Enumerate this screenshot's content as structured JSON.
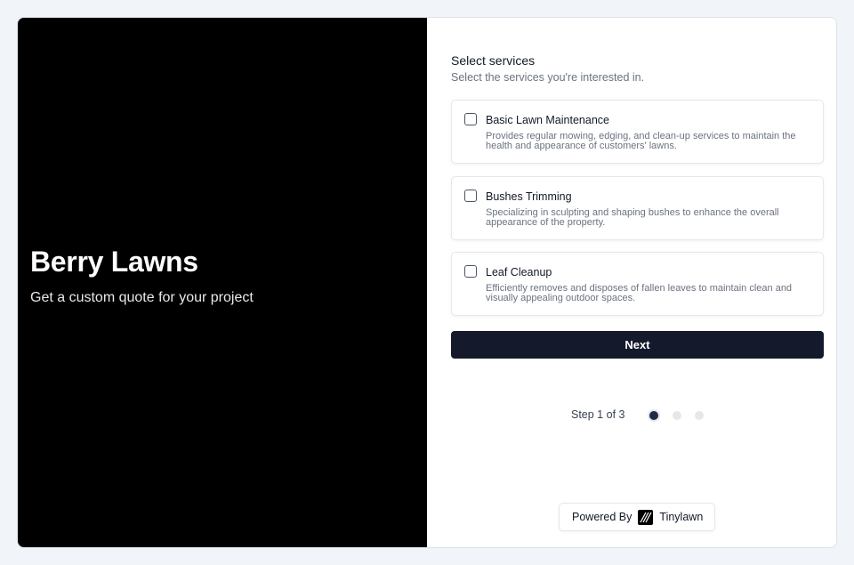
{
  "brand": {
    "title": "Berry Lawns",
    "subtitle": "Get a custom quote for your project"
  },
  "form": {
    "title": "Select services",
    "subtitle": "Select the services you're interested in.",
    "services": [
      {
        "name": "Basic Lawn Maintenance",
        "description": "Provides regular mowing, edging, and clean-up services to maintain the health and appearance of customers' lawns.",
        "checked": false
      },
      {
        "name": "Bushes Trimming",
        "description": "Specializing in sculpting and shaping bushes to enhance the overall appearance of the property.",
        "checked": false
      },
      {
        "name": "Leaf Cleanup",
        "description": "Efficiently removes and disposes of fallen leaves to maintain clean and visually appealing outdoor spaces.",
        "checked": false
      }
    ],
    "next_label": "Next"
  },
  "stepper": {
    "text": "Step 1 of 3",
    "current": 1,
    "total": 3
  },
  "footer": {
    "powered_label": "Powered By",
    "brand_name": "Tinylawn",
    "logo_icon": "tinylawn-logo-icon"
  },
  "colors": {
    "brand_panel": "#000000",
    "primary_button": "#141a2b",
    "active_dot": "#1f2a44",
    "inactive_dot": "#e5e7eb"
  }
}
